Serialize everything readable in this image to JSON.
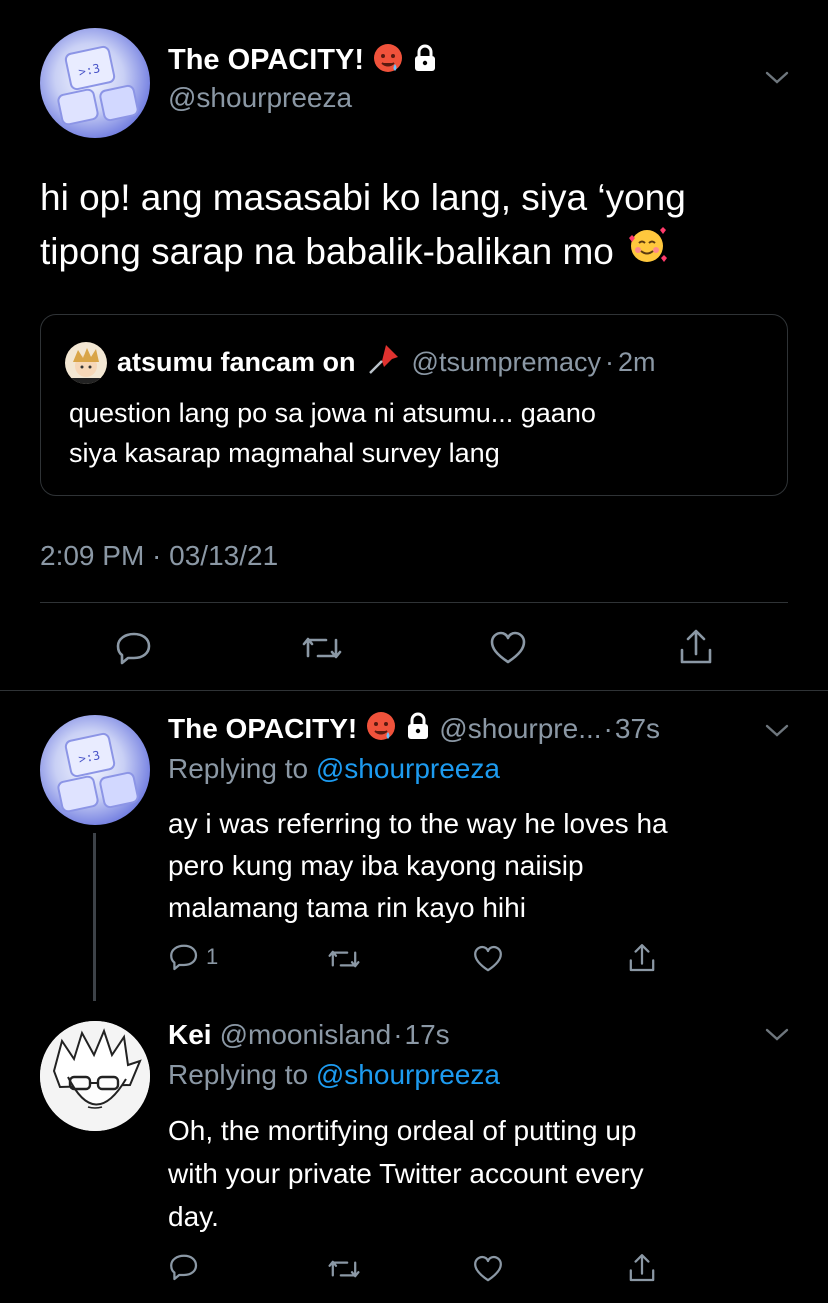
{
  "main_tweet": {
    "display_name": "The OPACITY!",
    "handle": "@shourpreeza",
    "text_line1": "hi op! ang masasabi ko lang, siya ‘yong",
    "text_line2": "tipong sarap na babalik-balikan mo",
    "quoted": {
      "display_name": "atsumu fancam on",
      "handle": "@tsumpremacy",
      "time": "2m",
      "text_line1": "question lang po sa jowa ni atsumu... gaano",
      "text_line2": "siya kasarap magmahal survey lang"
    },
    "timestamp": "2:09 PM · 03/13/21"
  },
  "replies": [
    {
      "display_name": "The OPACITY!",
      "handle": "@shourpre...",
      "time": "37s",
      "replying_prefix": "Replying to",
      "replying_to": "@shourpreeza",
      "text_lines": [
        "ay i was referring to the way he loves ha",
        "pero kung may iba kayong naiisip",
        "malamang tama rin kayo hihi"
      ],
      "reply_count": "1"
    },
    {
      "display_name": "Kei",
      "handle": "@moonisland",
      "time": "17s",
      "replying_prefix": "Replying to",
      "replying_to": "@shourpreeza",
      "text_lines": [
        "Oh, the mortifying ordeal of putting up",
        "with your private Twitter account every",
        "day."
      ]
    }
  ],
  "separator": "·",
  "colors": {
    "background": "#000000",
    "muted": "#8b98a5",
    "link": "#1d9bf0",
    "divider": "#2f3336"
  },
  "icons": [
    "reply-icon",
    "retweet-icon",
    "like-icon",
    "share-icon",
    "chevron-down-icon",
    "lock-icon",
    "hot-face-emoji",
    "smiling-hearts-emoji",
    "pushpin-emoji"
  ]
}
